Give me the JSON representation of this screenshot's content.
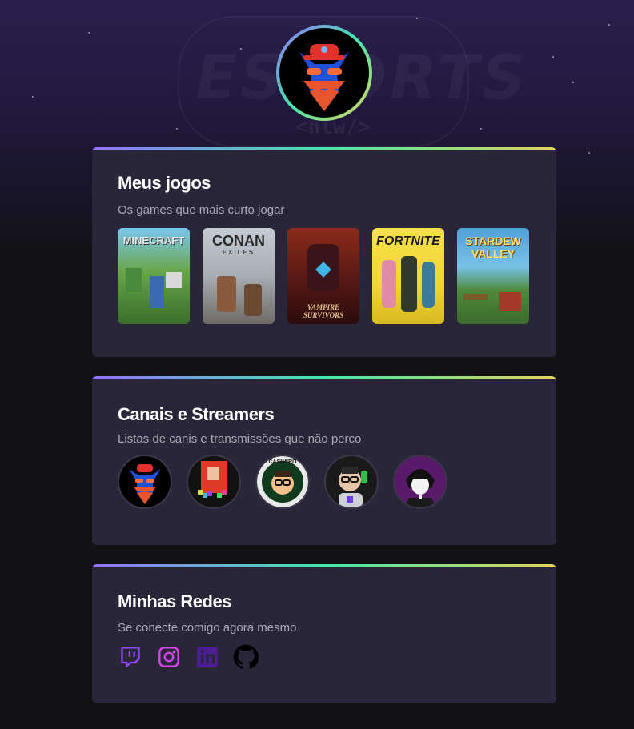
{
  "profile": {
    "avatar_icon": "fox-gamer-avatar"
  },
  "background": {
    "logo_text": "ESPORTS",
    "logo_sub": "<nlw/>"
  },
  "sections": {
    "games": {
      "title": "Meus jogos",
      "subtitle": "Os games que mais curto jogar",
      "items": [
        {
          "name": "MINECRAFT",
          "color": "#5d9b3a"
        },
        {
          "name": "CONAN",
          "subname": "EXILES",
          "color": "#8a93a0"
        },
        {
          "name": "VAMPIRE SURVIVORS",
          "color": "#5c1a16"
        },
        {
          "name": "FORTNITE",
          "color": "#f2d534"
        },
        {
          "name": "STARDEW VALLEY",
          "color": "#4f9fd8"
        }
      ]
    },
    "streamers": {
      "title": "Canais e Streamers",
      "subtitle": "Listas de canis e transmissões que não perco",
      "items": [
        {
          "name": "fox-avatar"
        },
        {
          "name": "pixel-avatar"
        },
        {
          "name": "CASIMIRO"
        },
        {
          "name": "headset-avatar"
        },
        {
          "name": "anime-avatar"
        }
      ]
    },
    "socials": {
      "title": "Minhas Redes",
      "subtitle": "Se conecte comigo agora mesmo",
      "items": [
        {
          "name": "twitch-icon",
          "color": "#9146ff"
        },
        {
          "name": "instagram-icon",
          "color": "#d946ef"
        },
        {
          "name": "linkedin-icon",
          "color": "#5b21b6"
        },
        {
          "name": "github-icon",
          "color": "#000000"
        }
      ]
    }
  }
}
